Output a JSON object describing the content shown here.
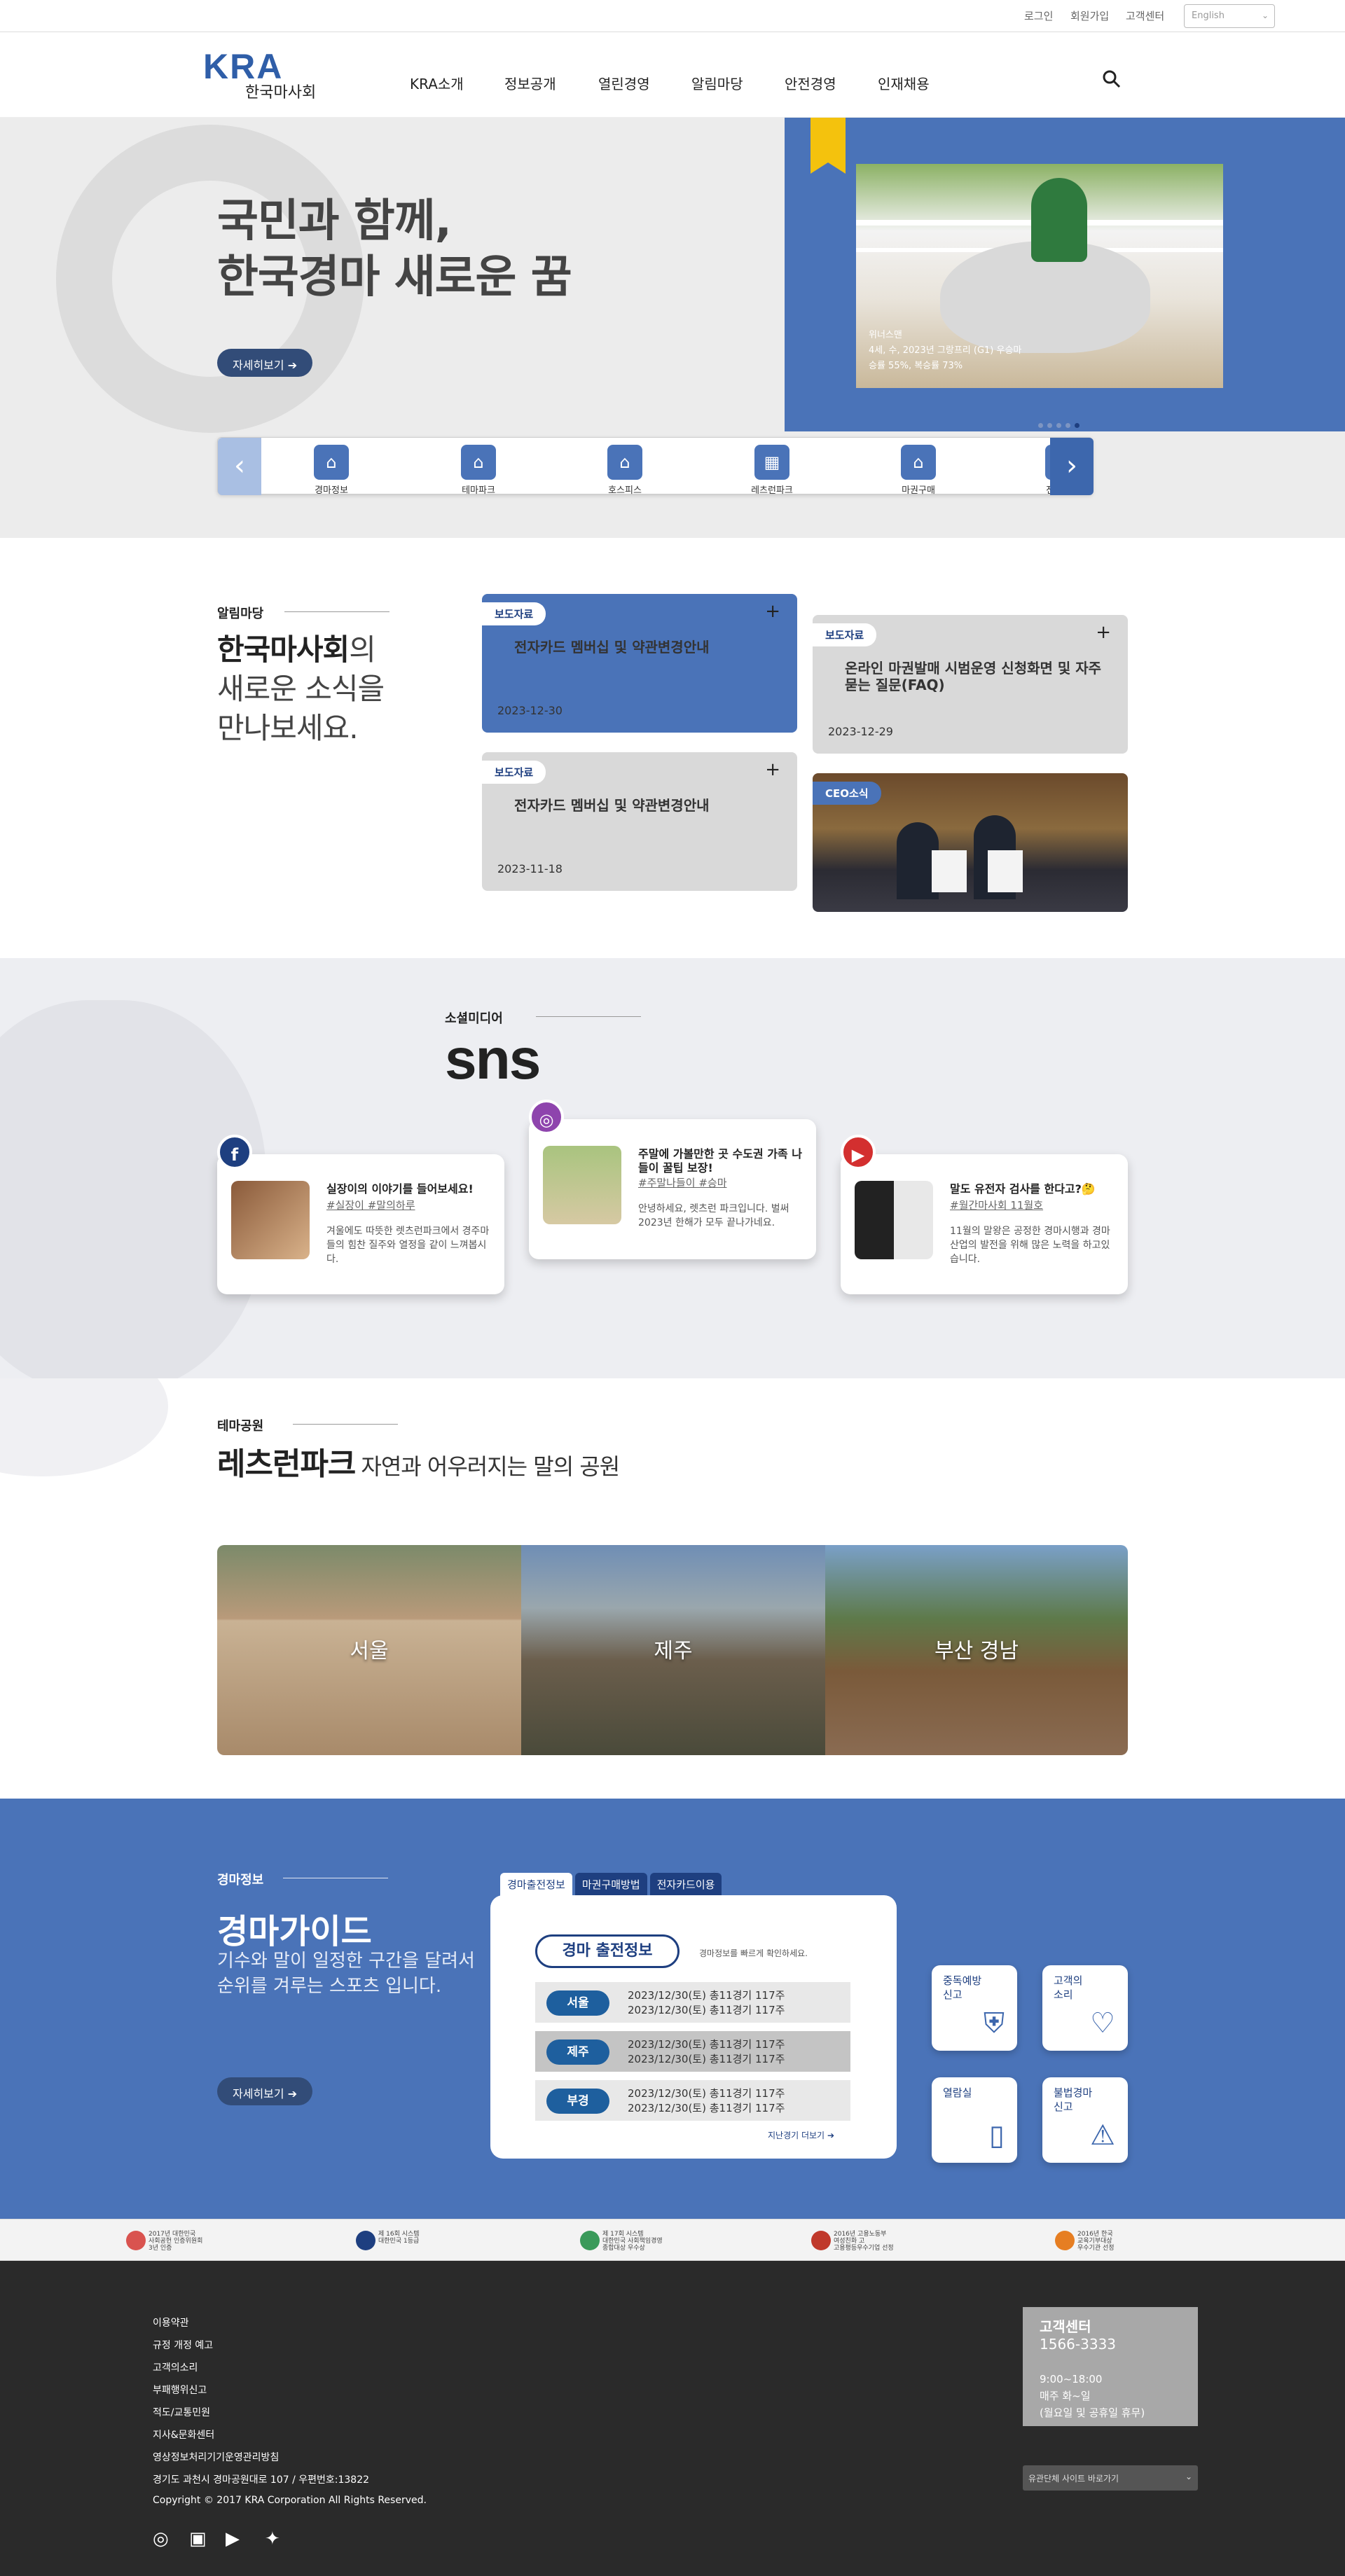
{
  "util": {
    "login": "로그인",
    "join": "회원가입",
    "service": "고객센터",
    "lang": "English"
  },
  "header": {
    "logo_kra": "KRA",
    "logo_name": "한국마사회",
    "nav": [
      "KRA소개",
      "정보공개",
      "열린경영",
      "알림마당",
      "안전경영",
      "인재채용"
    ]
  },
  "hero": {
    "title_line1": "국민과 함께,",
    "title_line2": "한국경마 새로운 꿈",
    "more": "자세히보기",
    "caption_line1": "위너스맨",
    "caption_line2": "4세, 수, 2023년 그랑프리 (G1) 우승마",
    "caption_line3": "승률 55%, 복승률 73%"
  },
  "quick": [
    "경마정보",
    "테마파크",
    "호스피스",
    "레츠런파크",
    "마권구매",
    "전자입찰"
  ],
  "news": {
    "tag": "알림마당",
    "title_b": "한국마사회",
    "title_rest1": "의",
    "title_line2": "새로운 소식을",
    "title_line3": "만나보세요.",
    "cards": [
      {
        "tag": "보도자료",
        "title": "전자카드 멤버십 및 약관변경안내",
        "date": "2023-12-30"
      },
      {
        "tag": "보도자료",
        "title": "온라인 마권발매 시범운영 신청화면 및 자주 묻는 질문(FAQ)",
        "date": "2023-12-29"
      },
      {
        "tag": "보도자료",
        "title": "전자카드 멤버십 및 약관변경안내",
        "date": "2023-11-18"
      },
      {
        "tag": "CEO소식"
      }
    ]
  },
  "sns": {
    "tag": "소셜미디어",
    "big": "sns",
    "cards": [
      {
        "icon": "f",
        "title": "실장이의 이야기를 들어보세요!",
        "hash": "#실장이 #말의하루",
        "body": "겨울에도 따뜻한 렛츠런파크에서 경주마들의 힘찬 질주와 열정을 같이 느껴봅시다."
      },
      {
        "icon": "◎",
        "title": "주말에 가볼만한 곳 수도권 가족 나들이 꿀팁 보장!",
        "hash": "#주말나들이 #승마",
        "body": "안녕하세요, 렛츠런 파크입니다. 벌써 2023년 한해가 모두 끝나가네요."
      },
      {
        "icon": "▶",
        "title": "말도 유전자 검사를 한다고?🤔",
        "hash": "#월간마사회 11월호",
        "body": "11월의 말왕은 공정한 경마시행과 경마 산업의 발전을 위해 많은 노력을 하고있습니다."
      }
    ]
  },
  "theme": {
    "tag": "테마공원",
    "title": "레츠런파크",
    "subtitle": "자연과 어우러지는 말의 공원",
    "parks": [
      "서울",
      "제주",
      "부산 경남"
    ]
  },
  "guide": {
    "tag": "경마정보",
    "title": "경마가이드",
    "sub_line1": "기수와 말이 일정한 구간을 달려서",
    "sub_line2": "순위를 겨루는 스포츠 입니다.",
    "more": "자세히보기",
    "tabs": [
      "경마출전정보",
      "마권구매방법",
      "전자카드이용"
    ],
    "panel_title": "경마 출전정보",
    "hint": "경마정보를 빠르게 확인하세요.",
    "rows": [
      {
        "place": "서울",
        "l1": "2023/12/30(토) 총11경기 117주",
        "l2": "2023/12/30(토) 총11경기 117주"
      },
      {
        "place": "제주",
        "l1": "2023/12/30(토) 총11경기 117주",
        "l2": "2023/12/30(토) 총11경기 117주"
      },
      {
        "place": "부경",
        "l1": "2023/12/30(토) 총11경기 117주",
        "l2": "2023/12/30(토) 총11경기 117주"
      }
    ],
    "past": "지난경기 더보기",
    "squares": [
      {
        "t1": "중독예방",
        "t2": "신고"
      },
      {
        "t1": "고객의",
        "t2": "소리"
      },
      {
        "t1": "열람실",
        "t2": ""
      },
      {
        "t1": "불법경마",
        "t2": "신고"
      }
    ]
  },
  "awards": [
    {
      "l1": "2017년 대한민국",
      "l2": "사회공헌 인증위원회",
      "l3": "3년 인증"
    },
    {
      "l1": "제 16회 시스템",
      "l2": "대한민국 1등급"
    },
    {
      "l1": "제 17회 시스템",
      "l2": "대한민국 사회책임경영",
      "l3": "종합대상 우수상"
    },
    {
      "l1": "2016년 고용노동부",
      "l2": "여성친화 고",
      "l3": "고용평등우수기업 선정"
    },
    {
      "l1": "2016년 한국",
      "l2": "교육기부대상",
      "l3": "우수기관 선정"
    }
  ],
  "footer": {
    "links": [
      "이용약관",
      "규정 개정 예고",
      "고객의소리",
      "부패행위신고",
      "적도/교통민원",
      "지사&문화센터",
      "영상정보처리기기운영관리방침"
    ],
    "address": "경기도 과천시 경마공원대로 107 / 우편번호:13822",
    "copyright": "Copyright © 2017 KRA Corporation All Rights Reserved.",
    "cc_title": "고객센터",
    "cc_phone": "1566-3333",
    "cc_hours": "9:00~18:00",
    "cc_days": "매주 화~일",
    "cc_note": "(월요일 및 공휴일 휴무)",
    "family": "유관단체 사이트 바로가기"
  },
  "colors": {
    "brand": "#4a73b8",
    "dark": "#1e3f80",
    "accent": "#f4c20d",
    "facebook": "#1e3f80",
    "instagram": "#8e44ad",
    "youtube": "#d32f2f"
  }
}
